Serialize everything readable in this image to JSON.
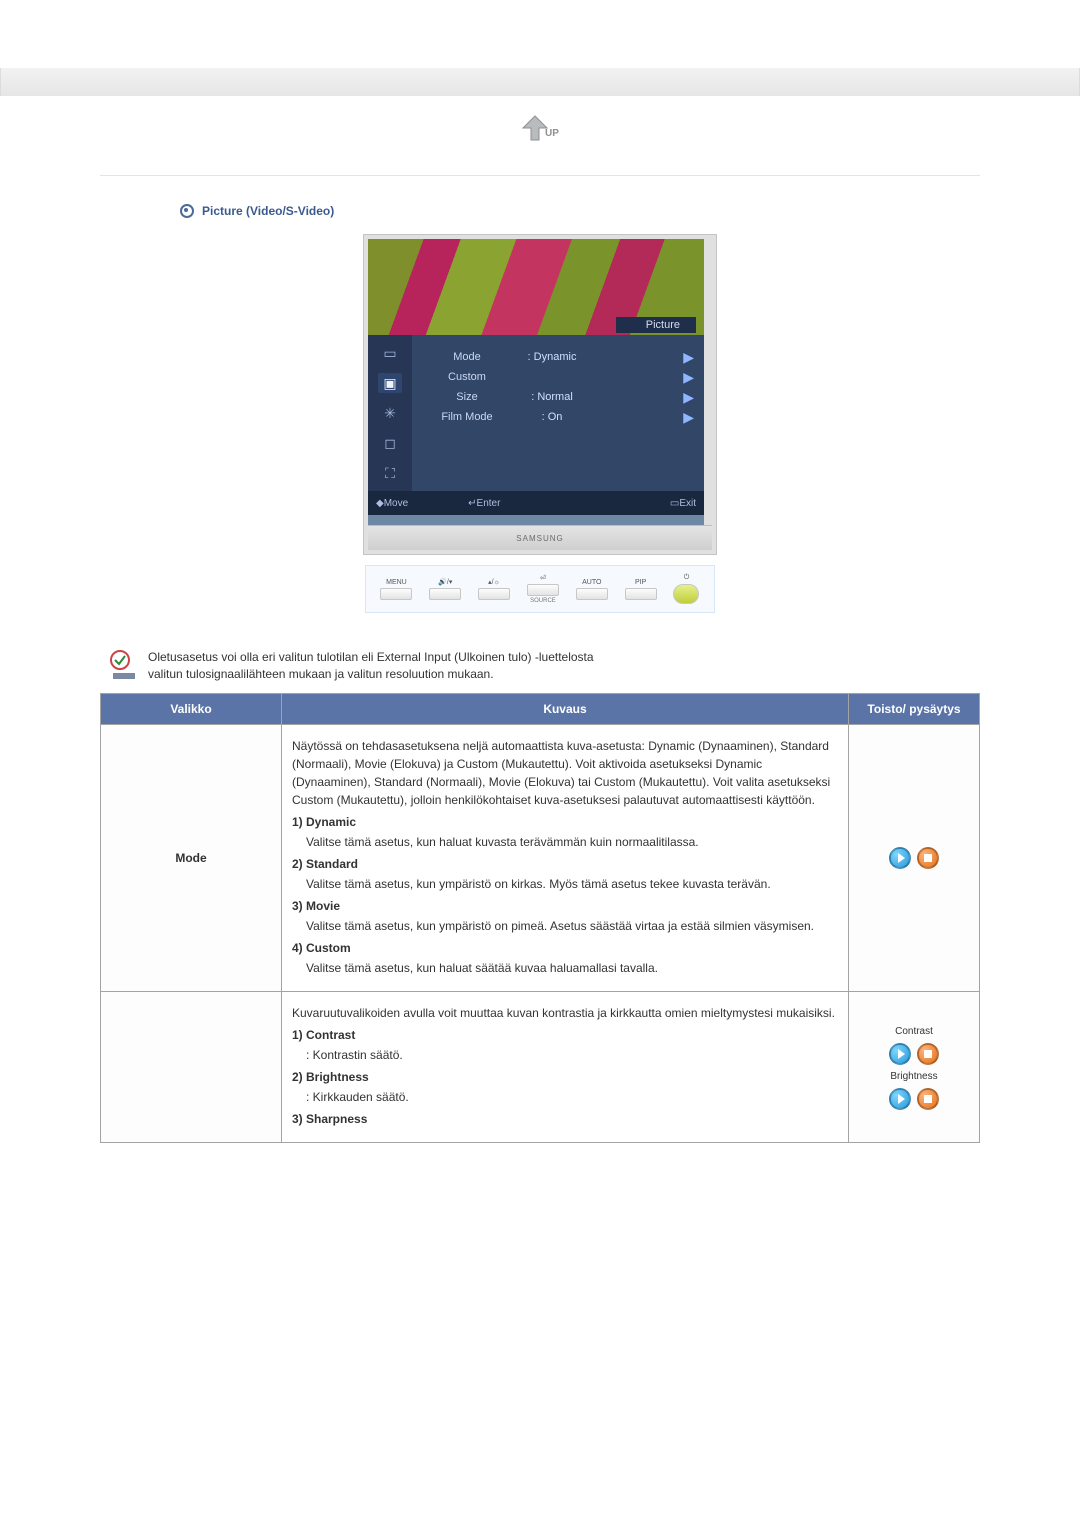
{
  "section": {
    "title": "Picture (Video/S-Video)"
  },
  "osd": {
    "panel_label": "Picture",
    "rows": [
      {
        "label": "Mode",
        "value": ": Dynamic"
      },
      {
        "label": "Custom",
        "value": ""
      },
      {
        "label": "Size",
        "value": ": Normal"
      },
      {
        "label": "Film Mode",
        "value": ": On"
      }
    ],
    "nav": {
      "move": "Move",
      "enter": "Enter",
      "exit": "Exit"
    },
    "brand": "SAMSUNG"
  },
  "monitor_buttons": {
    "menu": "MENU",
    "source": "SOURCE",
    "auto": "AUTO",
    "pip": "PIP"
  },
  "note": {
    "line1": "Oletusasetus voi olla eri valitun tulotilan eli External Input (Ulkoinen tulo) -luettelosta",
    "line2": "valitun tulosignaalilähteen mukaan ja valitun resoluution mukaan."
  },
  "table": {
    "headers": {
      "menu": "Valikko",
      "desc": "Kuvaus",
      "play": "Toisto/ pysäytys"
    },
    "rows": [
      {
        "menu": "Mode",
        "desc_intro": "Näytössä on tehdasasetuksena neljä automaattista kuva-asetusta: Dynamic (Dynaaminen), Standard (Normaali), Movie (Elokuva) ja Custom (Mukautettu). Voit aktivoida asetukseksi Dynamic (Dynaaminen), Standard (Normaali), Movie (Elokuva) tai Custom (Mukautettu). Voit valita asetukseksi Custom (Mukautettu), jolloin henkilökohtaiset kuva-asetuksesi palautuvat automaattisesti käyttöön.",
        "items": [
          {
            "title": "1) Dynamic",
            "text": "Valitse tämä asetus, kun haluat kuvasta terävämmän kuin normaalitilassa."
          },
          {
            "title": "2) Standard",
            "text": "Valitse tämä asetus, kun ympäristö on kirkas. Myös tämä asetus tekee kuvasta terävän."
          },
          {
            "title": "3) Movie",
            "text": "Valitse tämä asetus, kun ympäristö on pimeä. Asetus säästää virtaa ja estää silmien väsymisen."
          },
          {
            "title": "4) Custom",
            "text": "Valitse tämä asetus, kun haluat säätää kuvaa haluamallasi tavalla."
          }
        ],
        "play_labels": []
      },
      {
        "menu": "",
        "desc_intro": "Kuvaruutuvalikoiden avulla voit muuttaa kuvan kontrastia ja kirkkautta omien mieltymystesi mukaisiksi.",
        "items": [
          {
            "title": "1) Contrast",
            "text": ": Kontrastin säätö."
          },
          {
            "title": "2) Brightness",
            "text": ": Kirkkauden säätö."
          },
          {
            "title": "3) Sharpness",
            "text": ""
          }
        ],
        "play_labels": [
          "Contrast",
          "Brightness"
        ]
      }
    ]
  }
}
